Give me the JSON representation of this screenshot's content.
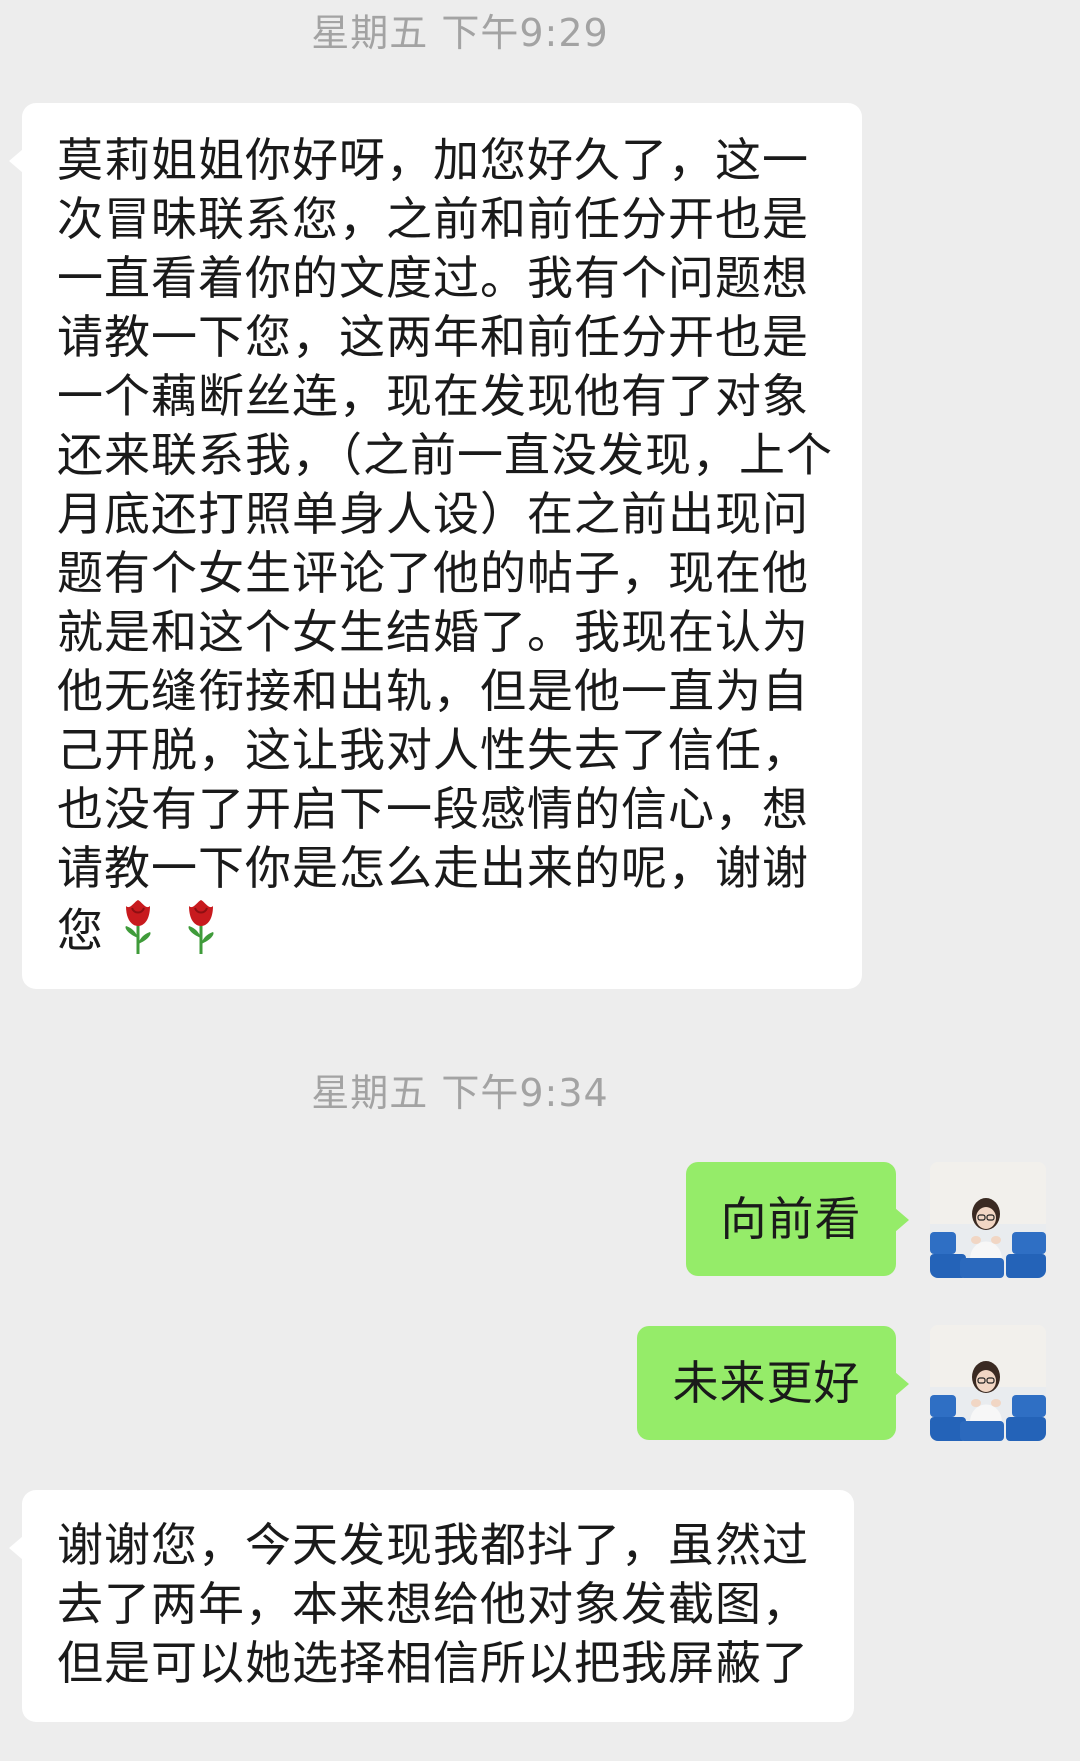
{
  "timestamps": [
    "星期五 下午9:29",
    "星期五 下午9:34"
  ],
  "messages": [
    {
      "side": "incoming",
      "text": "莫莉姐姐你好呀，加您好久了，这一\n次冒昧联系您，之前和前任分开也是\n一直看着你的文度过。我有个问题想\n请教一下您，这两年和前任分开也是\n一个藕断丝连，现在发现他有了对象\n还来联系我，（之前一直没发现，上个\n月底还打照单身人设）在之前出现问\n题有个女生评论了他的帖子，现在他\n就是和这个女生结婚了。我现在认为\n他无缝衔接和出轨，但是他一直为自\n己开脱，这让我对人性失去了信任，\n也没有了开启下一段感情的信心，想\n请教一下你是怎么走出来的呢，谢谢\n您",
      "emoji": [
        "rose-icon",
        "rose-icon"
      ]
    },
    {
      "side": "outgoing",
      "text": "向前看"
    },
    {
      "side": "outgoing",
      "text": "未来更好"
    },
    {
      "side": "incoming",
      "text": "谢谢您，今天发现我都抖了，虽然过\n去了两年，本来想给他对象发截图，\n但是可以她选择相信所以把我屏蔽了"
    }
  ],
  "colors": {
    "background": "#ededed",
    "incoming_bubble": "#ffffff",
    "outgoing_bubble": "#95ec69",
    "timestamp_text": "#a3a3a3",
    "rose": "#c81a1e",
    "leaf": "#3f9b3a"
  },
  "avatar": {
    "icon": "user-avatar-girl-in-stadium-seats"
  }
}
